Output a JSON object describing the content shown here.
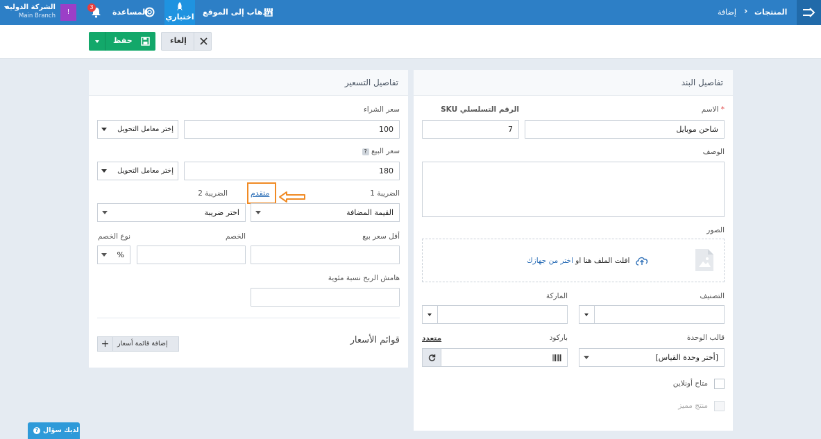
{
  "topbar": {
    "company_name": "الشركة الدولية",
    "branch": "Main Branch",
    "user_initial": "!",
    "notification_count": "3",
    "help_label": "المساعدة",
    "trial_label": "اختباري",
    "go_to_site_label": "الذهاب إلى الموقع",
    "breadcrumb_products": "المنتجات",
    "breadcrumb_add": "إضافة"
  },
  "actions": {
    "save_label": "حفظ",
    "cancel_label": "إلغاء"
  },
  "item_details": {
    "title": "تفاصيل البند",
    "name_label": "الاسم",
    "required_mark": "*",
    "name_value": "شاحن موبايل",
    "sku_label": "الرقم التسلسلي SKU",
    "sku_value": "7",
    "description_label": "الوصف",
    "images_label": "الصور",
    "upload_text": "افلت الملف هنا او",
    "upload_link": "اختر من جهازك",
    "category_label": "التصنيف",
    "brand_label": "الماركة",
    "unit_template_label": "قالب الوحدة",
    "unit_template_value": "[أختر وحدة القياس]",
    "barcode_label": "باركود",
    "multiple_label": "متعدد",
    "online_product_label": "متاح أونلاين",
    "featured_product_label": "منتج مميز"
  },
  "pricing": {
    "title": "تفاصيل التسعير",
    "purchase_price_label": "سعر الشراء",
    "purchase_price_value": "100",
    "conversion_placeholder": "إختر معامل التحويل",
    "selling_price_label": "سعر البيع",
    "help_badge": "?",
    "selling_price_value": "180",
    "tax1_label": "الضريبة 1",
    "tax1_value": "القيمة المضافة",
    "advanced_link": "متقدم",
    "tax2_label": "الضريبة 2",
    "tax2_value": "اختر ضريبة",
    "min_price_label": "أقل سعر بيع",
    "discount_label": "الخصم",
    "discount_type_label": "نوع الخصم",
    "discount_type_value": "%",
    "profit_margin_label": "هامش الربح نسبة مئوية",
    "price_lists_title": "قوائم الأسعار",
    "add_price_list_label": "إضافة قائمة أسعار",
    "plus_label": "+"
  },
  "help_button_label": "لديك سؤال",
  "colors": {
    "topbar": "#2d7fc6",
    "save": "#13a86a",
    "highlight": "#f08a24",
    "link": "#2d6fb7"
  }
}
